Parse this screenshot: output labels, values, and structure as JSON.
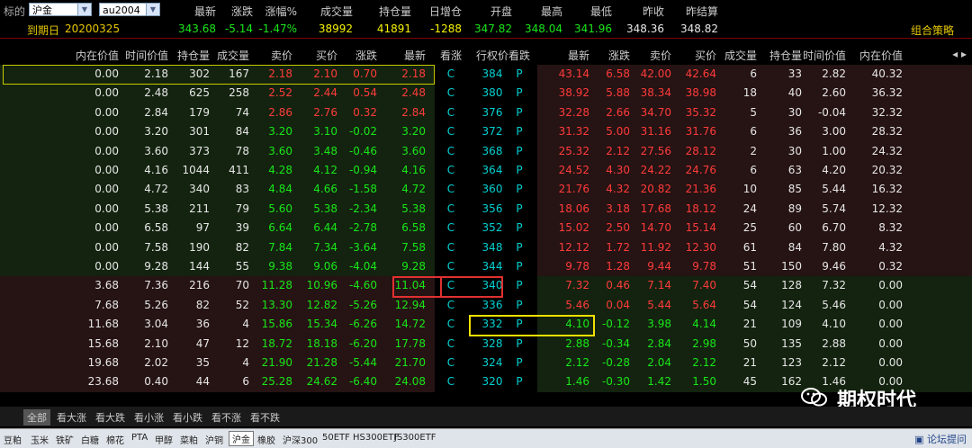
{
  "header": {
    "target_label": "标的",
    "underlying": "沪金",
    "contract": "au2004",
    "expiry_label": "到期日",
    "expiry_date": "20200325",
    "strategy_link": "组合策略",
    "quote_headers": [
      "最新",
      "涨跌",
      "涨幅%",
      "成交量",
      "持仓量",
      "日增仓",
      "开盘",
      "最高",
      "最低",
      "昨收",
      "昨结算"
    ],
    "quote_values": [
      "343.68",
      "-5.14",
      "-1.47%",
      "38992",
      "41891",
      "-1288",
      "347.82",
      "348.04",
      "341.96",
      "348.36",
      "348.82"
    ]
  },
  "table": {
    "call_headers": [
      "内在价值",
      "时间价值",
      "持仓量",
      "成交量",
      "卖价",
      "买价",
      "涨跌",
      "最新"
    ],
    "mid_headers": [
      "看涨",
      "行权价",
      "看跌"
    ],
    "put_headers": [
      "最新",
      "涨跌",
      "卖价",
      "买价",
      "成交量",
      "持仓量",
      "时间价值",
      "内在价值"
    ],
    "nav_arrows": "◂ ▸",
    "rows": [
      {
        "call": [
          "0.00",
          "2.18",
          "302",
          "167",
          "2.18",
          "2.10",
          "0.70",
          "2.18"
        ],
        "c": "C",
        "strike": "384",
        "p": "P",
        "put": [
          "43.14",
          "6.58",
          "42.00",
          "42.64",
          "6",
          "33",
          "2.82",
          "40.32"
        ]
      },
      {
        "call": [
          "0.00",
          "2.48",
          "625",
          "258",
          "2.52",
          "2.44",
          "0.54",
          "2.48"
        ],
        "c": "C",
        "strike": "380",
        "p": "P",
        "put": [
          "38.92",
          "5.88",
          "38.34",
          "38.98",
          "18",
          "40",
          "2.60",
          "36.32"
        ]
      },
      {
        "call": [
          "0.00",
          "2.84",
          "179",
          "74",
          "2.86",
          "2.76",
          "0.32",
          "2.84"
        ],
        "c": "C",
        "strike": "376",
        "p": "P",
        "put": [
          "32.28",
          "2.66",
          "34.70",
          "35.32",
          "5",
          "30",
          "-0.04",
          "32.32"
        ]
      },
      {
        "call": [
          "0.00",
          "3.20",
          "301",
          "84",
          "3.20",
          "3.10",
          "-0.02",
          "3.20"
        ],
        "c": "C",
        "strike": "372",
        "p": "P",
        "put": [
          "31.32",
          "5.00",
          "31.16",
          "31.76",
          "6",
          "36",
          "3.00",
          "28.32"
        ]
      },
      {
        "call": [
          "0.00",
          "3.60",
          "373",
          "78",
          "3.60",
          "3.48",
          "-0.46",
          "3.60"
        ],
        "c": "C",
        "strike": "368",
        "p": "P",
        "put": [
          "25.32",
          "2.12",
          "27.56",
          "28.12",
          "2",
          "30",
          "1.00",
          "24.32"
        ]
      },
      {
        "call": [
          "0.00",
          "4.16",
          "1044",
          "411",
          "4.28",
          "4.12",
          "-0.94",
          "4.16"
        ],
        "c": "C",
        "strike": "364",
        "p": "P",
        "put": [
          "24.52",
          "4.30",
          "24.22",
          "24.76",
          "6",
          "63",
          "4.20",
          "20.32"
        ]
      },
      {
        "call": [
          "0.00",
          "4.72",
          "340",
          "83",
          "4.84",
          "4.66",
          "-1.58",
          "4.72"
        ],
        "c": "C",
        "strike": "360",
        "p": "P",
        "put": [
          "21.76",
          "4.32",
          "20.82",
          "21.36",
          "10",
          "85",
          "5.44",
          "16.32"
        ]
      },
      {
        "call": [
          "0.00",
          "5.38",
          "211",
          "79",
          "5.60",
          "5.38",
          "-2.34",
          "5.38"
        ],
        "c": "C",
        "strike": "356",
        "p": "P",
        "put": [
          "18.06",
          "3.18",
          "17.68",
          "18.12",
          "24",
          "89",
          "5.74",
          "12.32"
        ]
      },
      {
        "call": [
          "0.00",
          "6.58",
          "97",
          "39",
          "6.64",
          "6.44",
          "-2.78",
          "6.58"
        ],
        "c": "C",
        "strike": "352",
        "p": "P",
        "put": [
          "15.02",
          "2.50",
          "14.70",
          "15.14",
          "25",
          "60",
          "6.70",
          "8.32"
        ]
      },
      {
        "call": [
          "0.00",
          "7.58",
          "190",
          "82",
          "7.84",
          "7.34",
          "-3.64",
          "7.58"
        ],
        "c": "C",
        "strike": "348",
        "p": "P",
        "put": [
          "12.12",
          "1.72",
          "11.92",
          "12.30",
          "61",
          "84",
          "7.80",
          "4.32"
        ]
      },
      {
        "call": [
          "0.00",
          "9.28",
          "144",
          "55",
          "9.38",
          "9.06",
          "-4.04",
          "9.28"
        ],
        "c": "C",
        "strike": "344",
        "p": "P",
        "put": [
          "9.78",
          "1.28",
          "9.44",
          "9.78",
          "51",
          "150",
          "9.46",
          "0.32"
        ]
      },
      {
        "call": [
          "3.68",
          "7.36",
          "216",
          "70",
          "11.28",
          "10.96",
          "-4.60",
          "11.04"
        ],
        "c": "C",
        "strike": "340",
        "p": "P",
        "put": [
          "7.32",
          "0.46",
          "7.14",
          "7.40",
          "54",
          "128",
          "7.32",
          "0.00"
        ]
      },
      {
        "call": [
          "7.68",
          "5.26",
          "82",
          "52",
          "13.30",
          "12.82",
          "-5.26",
          "12.94"
        ],
        "c": "C",
        "strike": "336",
        "p": "P",
        "put": [
          "5.46",
          "0.04",
          "5.44",
          "5.64",
          "54",
          "124",
          "5.46",
          "0.00"
        ]
      },
      {
        "call": [
          "11.68",
          "3.04",
          "36",
          "4",
          "15.86",
          "15.34",
          "-6.26",
          "14.72"
        ],
        "c": "C",
        "strike": "332",
        "p": "P",
        "put": [
          "4.10",
          "-0.12",
          "3.98",
          "4.14",
          "21",
          "109",
          "4.10",
          "0.00"
        ]
      },
      {
        "call": [
          "15.68",
          "2.10",
          "47",
          "12",
          "18.72",
          "18.18",
          "-6.20",
          "17.78"
        ],
        "c": "C",
        "strike": "328",
        "p": "P",
        "put": [
          "2.88",
          "-0.34",
          "2.84",
          "2.98",
          "50",
          "135",
          "2.88",
          "0.00"
        ]
      },
      {
        "call": [
          "19.68",
          "2.02",
          "35",
          "4",
          "21.90",
          "21.28",
          "-5.44",
          "21.70"
        ],
        "c": "C",
        "strike": "324",
        "p": "P",
        "put": [
          "2.12",
          "-0.28",
          "2.04",
          "2.12",
          "21",
          "123",
          "2.12",
          "0.00"
        ]
      },
      {
        "call": [
          "23.68",
          "0.40",
          "44",
          "6",
          "25.28",
          "24.62",
          "-6.40",
          "24.08"
        ],
        "c": "C",
        "strike": "320",
        "p": "P",
        "put": [
          "1.46",
          "-0.30",
          "1.42",
          "1.50",
          "45",
          "162",
          "1.46",
          "0.00"
        ]
      }
    ]
  },
  "filters": [
    "全部",
    "看大涨",
    "看大跌",
    "看小涨",
    "看小跌",
    "看不涨",
    "看不跌"
  ],
  "products": [
    "豆粕",
    "玉米",
    "铁矿",
    "白糖",
    "棉花",
    "PTA",
    "甲醇",
    "菜粕",
    "沪铜",
    "沪金",
    "橡胶",
    "沪深300",
    "50ETF",
    "HS300ETF",
    "JS300ETF"
  ],
  "watermark": "期权时代",
  "forum_link": "论坛提问",
  "colors": {
    "up": "#ff3b3b",
    "down": "#19e619",
    "flat": "#e6e6e6",
    "accent": "#f5f200",
    "cyan": "#00d0d0",
    "itm_call_bg": "#182818",
    "otm_call_bg": "#281818"
  }
}
